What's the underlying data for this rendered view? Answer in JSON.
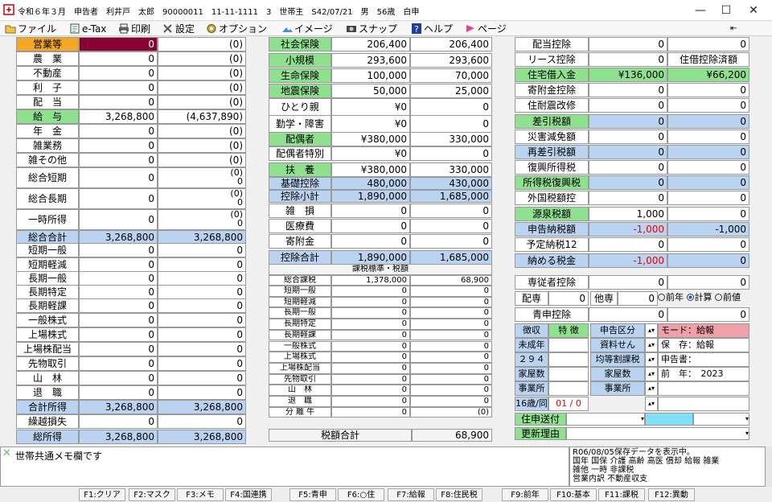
{
  "titlebar": {
    "text": "令和６年３月　申告者　利井戸　太郎　90000011　11-11-1111　3　世帯主　S42/07/21　男　56歳　白申",
    "minimize": "—",
    "maximize": "☐",
    "close": "✕"
  },
  "menu": [
    {
      "label": "ファイル",
      "icon": "folder-icon"
    },
    {
      "label": "e-Tax",
      "icon": "etax-icon"
    },
    {
      "label": "印刷",
      "icon": "printer-icon"
    },
    {
      "label": "設定",
      "icon": "tools-icon"
    },
    {
      "label": "オプション",
      "icon": "gear-icon"
    },
    {
      "label": "イメージ",
      "icon": "image-icon"
    },
    {
      "label": "スナップ",
      "icon": "camera-icon"
    },
    {
      "label": "ヘルプ",
      "icon": "help-icon"
    },
    {
      "label": "ページ",
      "icon": "page-icon"
    }
  ],
  "pin": "⇤",
  "col1": {
    "rows": [
      {
        "label": "営業等",
        "v1": "0",
        "v2": "(0)"
      },
      {
        "label": "農　業",
        "v1": "0",
        "v2": "(0)"
      },
      {
        "label": "不動産",
        "v1": "0",
        "v2": "(0)"
      },
      {
        "label": "利　子",
        "v1": "0",
        "v2": "(0)"
      },
      {
        "label": "配　当",
        "v1": "0",
        "v2": "(0)"
      },
      {
        "label": "給　与",
        "v1": "3,268,800",
        "v2": "(4,637,890)"
      },
      {
        "label": "年　金",
        "v1": "0",
        "v2": "(0)"
      },
      {
        "label": "雑業務",
        "v1": "0",
        "v2": "(0)"
      },
      {
        "label": "雑その他",
        "v1": "0",
        "v2": "(0)"
      },
      {
        "label": "総合短期",
        "v1": "0",
        "v2a": "(0)",
        "v2b": "0"
      },
      {
        "label": "総合長期",
        "v1": "0",
        "v2a": "(0)",
        "v2b": "0"
      },
      {
        "label": "一時所得",
        "v1": "0",
        "v2a": "(0)",
        "v2b": "0"
      },
      {
        "label": "総合合計",
        "v1": "3,268,800",
        "v2": "3,268,800"
      },
      {
        "label": "短期一般",
        "v1": "0",
        "v2": "0"
      },
      {
        "label": "短期軽減",
        "v1": "0",
        "v2": "0"
      },
      {
        "label": "長期一般",
        "v1": "0",
        "v2": "0"
      },
      {
        "label": "長期特定",
        "v1": "0",
        "v2": "0"
      },
      {
        "label": "長期軽課",
        "v1": "0",
        "v2": "0"
      },
      {
        "label": "一般株式",
        "v1": "0",
        "v2": "0"
      },
      {
        "label": "上場株式",
        "v1": "0",
        "v2": "0"
      },
      {
        "label": "上場株配当",
        "v1": "0",
        "v2": "0"
      },
      {
        "label": "先物取引",
        "v1": "0",
        "v2": "0"
      },
      {
        "label": "山　林",
        "v1": "0",
        "v2": "0"
      },
      {
        "label": "退　職",
        "v1": "0",
        "v2": "0"
      },
      {
        "label": "合計所得",
        "v1": "3,268,800",
        "v2": "3,268,800"
      },
      {
        "label": "繰越損失",
        "v1": "0",
        "v2": "0"
      },
      {
        "label": "総所得",
        "v1": "3,268,800",
        "v2": "3,268,800"
      }
    ]
  },
  "col2": {
    "rows": [
      {
        "label": "社会保険",
        "v1": "206,400",
        "v2": "206,400"
      },
      {
        "label": "小規模",
        "v1": "293,600",
        "v2": "293,600"
      },
      {
        "label": "生命保険",
        "v1": "100,000",
        "v2": "70,000"
      },
      {
        "label": "地震保険",
        "v1": "50,000",
        "v2": "25,000"
      },
      {
        "label": "ひとり親",
        "v1": "¥0",
        "v2": "0"
      },
      {
        "label": "勤学・障害",
        "v1": "¥0",
        "v2": "0"
      },
      {
        "label": "配偶者",
        "v1": "¥380,000",
        "v2": "330,000"
      },
      {
        "label": "配偶者特別",
        "v1": "¥0",
        "v2": "0"
      },
      {
        "label": "扶　養",
        "v1": "¥380,000",
        "v2": "330,000"
      },
      {
        "label": "基礎控除",
        "v1": "480,000",
        "v2": "430,000"
      },
      {
        "label": "控除小計",
        "v1": "1,890,000",
        "v2": "1,685,000"
      },
      {
        "label": "雑　損",
        "v1": "0",
        "v2": "0"
      },
      {
        "label": "医療費",
        "v1": "0",
        "v2": "0"
      },
      {
        "label": "寄附金",
        "v1": "0",
        "v2": "0"
      },
      {
        "label": "控除合計",
        "v1": "1,890,000",
        "v2": "1,685,000"
      }
    ],
    "section_header": "課税標準・税額",
    "tax_rows": [
      {
        "label": "総合課税",
        "v1": "1,378,000",
        "v2": "68,900"
      },
      {
        "label": "短期一般",
        "v1": "0",
        "v2": "0"
      },
      {
        "label": "短期軽減",
        "v1": "0",
        "v2": "0"
      },
      {
        "label": "長期一般",
        "v1": "0",
        "v2": "0"
      },
      {
        "label": "長期特定",
        "v1": "0",
        "v2": "0"
      },
      {
        "label": "長期軽課",
        "v1": "0",
        "v2": "0"
      },
      {
        "label": "一般株式",
        "v1": "0",
        "v2": "0"
      },
      {
        "label": "上場株式",
        "v1": "0",
        "v2": "0"
      },
      {
        "label": "上場株配当",
        "v1": "0",
        "v2": "0"
      },
      {
        "label": "先物取引",
        "v1": "0",
        "v2": "0"
      },
      {
        "label": "山　林",
        "v1": "0",
        "v2": "0"
      },
      {
        "label": "退　職",
        "v1": "0",
        "v2": "0"
      },
      {
        "label": "分 離 牛",
        "v1": "0",
        "v2": "(0)"
      }
    ],
    "total_label": "税額合計",
    "total_value": "68,900"
  },
  "col3": {
    "rows": [
      {
        "label": "配当控除",
        "v1": "0",
        "v2": "0"
      },
      {
        "label": "リース控除",
        "v1": "0",
        "v2": "住借控除済額"
      },
      {
        "label": "住宅借入金",
        "v1": "¥136,000",
        "v2": "¥66,200"
      },
      {
        "label": "寄附金控除",
        "v1": "0",
        "v2": "0"
      },
      {
        "label": "住耐震改修",
        "v1": "0",
        "v2": "0"
      },
      {
        "label": "差引税額",
        "v1": "0",
        "v2": "0"
      },
      {
        "label": "災害減免額",
        "v1": "0",
        "v2": "0"
      },
      {
        "label": "再差引税額",
        "v1": "0",
        "v2": "0"
      },
      {
        "label": "復興所得税",
        "v1": "0",
        "v2": "0"
      },
      {
        "label": "所得税復興税",
        "v1": "0",
        "v2": "0"
      },
      {
        "label": "外国税額控",
        "v1": "0",
        "v2": "0"
      },
      {
        "label": "源泉税額",
        "v1": "1,000",
        "v2": "0"
      },
      {
        "label": "申告納税額",
        "v1": "-1,000",
        "v2": "-1,000"
      },
      {
        "label": "予定納税12",
        "v1": "0",
        "v2": "0"
      },
      {
        "label": "納める税金",
        "v1": "-1,000",
        "v2": "0"
      }
    ],
    "senju_label": "専従者控除",
    "senju_v1": "0",
    "senju_v2": "0",
    "haisen_label": "配専",
    "haisen_v": "0",
    "taisen_label": "他専",
    "taisen_v": "0",
    "radio": [
      "前年",
      "計算",
      "前値"
    ],
    "aoshin_label": "青申控除",
    "aoshin_v": "0",
    "aoshin_v2": "0",
    "grid": {
      "left": [
        "徴収",
        "未成年",
        "２９４",
        "家屋数",
        "事業所",
        "16歳/同"
      ],
      "left_vals": [
        "特 徴",
        "",
        "",
        "",
        "",
        "01 / 0"
      ],
      "mid": [
        "申告区分",
        "資料せん",
        "均等割課税",
        "家屋数",
        "事業所",
        ""
      ],
      "right": [
        "モード：給報",
        "保　存：給報",
        "申告書：",
        "前　年：　2023",
        "",
        ""
      ]
    },
    "jushin_label": "住申送付",
    "koushin_label": "更新理由"
  },
  "memo": {
    "icon": "✕",
    "text": "世帯共通メモ欄です"
  },
  "message": "R06/08/05保存データを表示中。\n国年 国保 介護 高齢 高医 償却 給報 雑業\n雑他 一時 非課税\n営業内訳 不動産収支",
  "fkeys": [
    "F1:クリア",
    "F2:マスク",
    "F3:メモ",
    "F4:国連携",
    "F5:青申",
    "F6:○住",
    "F7:給報",
    "F8:住民税",
    "F9:前年",
    "F10:基本",
    "F11:課税",
    "F12:異動"
  ],
  "colors": {
    "orange": "#f5a623",
    "green": "#8fe08f",
    "blue": "#b9d3f0",
    "red": "#e00000",
    "maroon": "#8b0033",
    "pink": "#f0a0a8",
    "cyan": "#7fe0f8"
  }
}
